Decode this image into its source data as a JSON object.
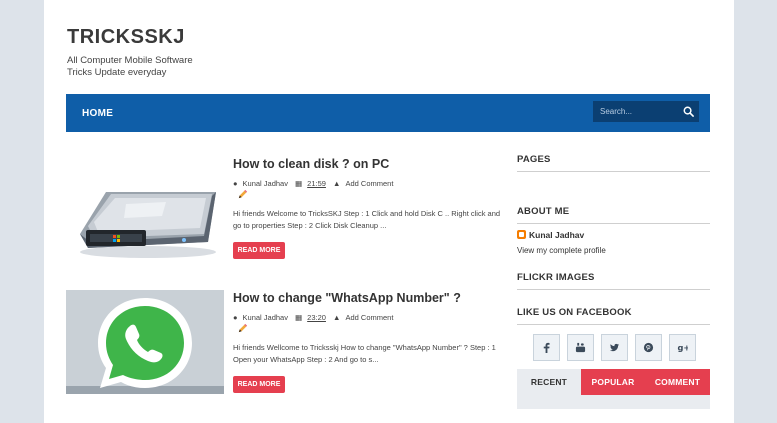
{
  "site": {
    "title": "TRICKSSKJ",
    "description": "All Computer Mobile Software Tricks Update everyday"
  },
  "nav": {
    "home_label": "HOME",
    "search_placeholder": "Search...",
    "icons": {
      "search": "search-icon"
    }
  },
  "posts": [
    {
      "title": "How to clean disk ? on PC",
      "author": "Kunal Jadhav",
      "time": "21:59",
      "comment_label": "Add Comment",
      "snippet": "Hi friends Welcome to TricksSKJ Step : 1 Click and hold Disk C .. Right click and go to properties Step : 2 Click Disk Cleanup ...",
      "read_more": "READ MORE",
      "thumbnail_icon": "hard-disk-icon"
    },
    {
      "title": "How to change \"WhatsApp Number\" ?",
      "author": "Kunal Jadhav",
      "time": "23:20",
      "comment_label": "Add Comment",
      "snippet": "Hi friends Wellcome to Tricksskj How to change \"WhatsApp Number\" ? Step : 1 Open your   WhatsApp Step : 2 And go to s...",
      "read_more": "READ MORE",
      "thumbnail_icon": "whatsapp-icon"
    }
  ],
  "sidebar": {
    "pages_title": "PAGES",
    "about_title": "ABOUT ME",
    "about_name": "Kunal Jadhav",
    "profile_link": "View my complete profile",
    "flickr_title": "FLICKR IMAGES",
    "facebook_title": "LIKE US ON FACEBOOK",
    "social_icons": [
      "facebook-icon",
      "youtube-icon",
      "twitter-icon",
      "pinterest-icon",
      "google-plus-icon"
    ],
    "tabs": [
      "RECENT",
      "POPULAR",
      "COMMENT"
    ]
  },
  "colors": {
    "nav": "#0f5ea8",
    "search_bg": "#0b3f72",
    "accent": "#e53f4f",
    "background": "#dde3ea"
  }
}
